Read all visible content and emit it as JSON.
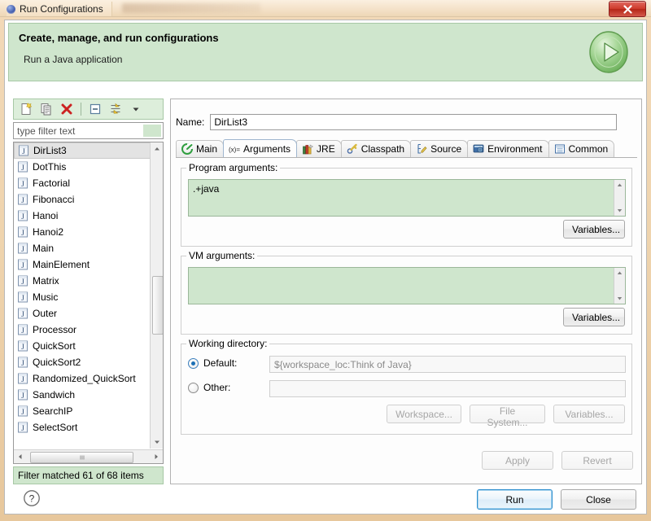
{
  "window": {
    "title": "Run Configurations",
    "title_icon": "eclipse-sphere-icon",
    "close_label": "close-icon"
  },
  "banner": {
    "title": "Create, manage, and run configurations",
    "subtitle": "Run a Java application",
    "icon": "run-green-play-icon"
  },
  "left_panel": {
    "toolbar": [
      {
        "name": "new-launch-configuration",
        "icon": "new-document-icon"
      },
      {
        "name": "duplicate-launch-configuration",
        "icon": "copy-icon"
      },
      {
        "name": "delete-launch-configuration",
        "icon": "delete-red-x-icon"
      },
      {
        "name": "collapse-all",
        "icon": "collapse-all-icon"
      },
      {
        "name": "filter-launch-configurations",
        "icon": "filter-icon"
      },
      {
        "name": "view-menu",
        "icon": "chevron-down-icon"
      }
    ],
    "filter": {
      "placeholder": "type filter text",
      "value": ""
    },
    "tree_items": [
      "DirList3",
      "DotThis",
      "Factorial",
      "Fibonacci",
      "Hanoi",
      "Hanoi2",
      "Main",
      "MainElement",
      "Matrix",
      "Music",
      "Outer",
      "Processor",
      "QuickSort",
      "QuickSort2",
      "Randomized_QuickSort",
      "Sandwich",
      "SearchIP",
      "SelectSort"
    ],
    "selected_item": "DirList3",
    "item_icon": "java-class-icon",
    "status": "Filter matched 61 of 68 items"
  },
  "right_panel": {
    "name_label": "Name:",
    "name_value": "DirList3",
    "tabs": [
      {
        "label": "Main",
        "icon": "main-green-arrow-icon",
        "active": false
      },
      {
        "label": "Arguments",
        "icon": "arguments-xequals-icon",
        "active": true
      },
      {
        "label": "JRE",
        "icon": "jre-books-icon",
        "active": false
      },
      {
        "label": "Classpath",
        "icon": "classpath-icon",
        "active": false
      },
      {
        "label": "Source",
        "icon": "source-icon",
        "active": false
      },
      {
        "label": "Environment",
        "icon": "environment-icon",
        "active": false
      },
      {
        "label": "Common",
        "icon": "common-icon",
        "active": false
      }
    ],
    "program_arguments": {
      "label": "Program arguments:",
      "value": ".+java",
      "variables_button": "Variables..."
    },
    "vm_arguments": {
      "label": "VM arguments:",
      "value": "",
      "variables_button": "Variables..."
    },
    "working_directory": {
      "label": "Working directory:",
      "default_label": "Default:",
      "default_checked": true,
      "default_value": "${workspace_loc:Think of Java}",
      "other_label": "Other:",
      "other_checked": false,
      "other_value": "",
      "buttons": [
        {
          "label": "Workspace...",
          "disabled": true
        },
        {
          "label": "File System...",
          "disabled": true
        },
        {
          "label": "Variables...",
          "disabled": true
        }
      ]
    },
    "apply_button": {
      "label": "Apply",
      "disabled": true
    },
    "revert_button": {
      "label": "Revert",
      "disabled": true
    }
  },
  "footer": {
    "help_icon": "help-question-icon",
    "run_button": "Run",
    "close_button": "Close"
  },
  "colors": {
    "banner_bg": "#cfe6cd",
    "field_green": "#cfe6cd",
    "frame": "#efd4ae",
    "accent_blue": "#2e8fce",
    "delete_red": "#cc2222"
  }
}
